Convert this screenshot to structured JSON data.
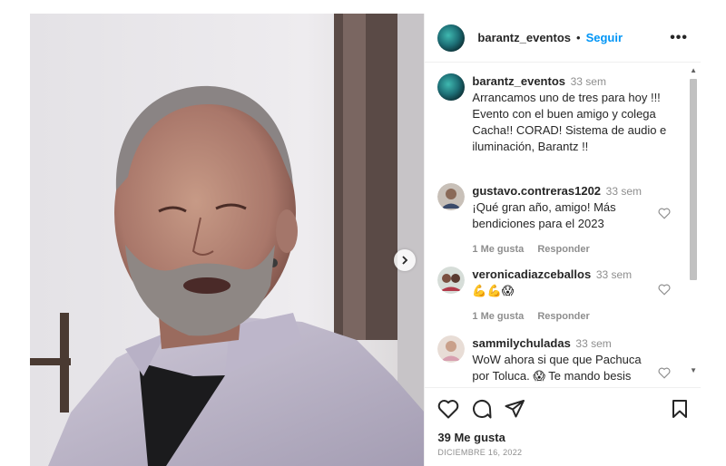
{
  "post": {
    "username": "barantz_eventos",
    "separator": "•",
    "follow_label": "Seguir",
    "more_label": "•••",
    "caption": {
      "username": "barantz_eventos",
      "time": "33 sem",
      "text": "Arrancamos uno de tres para hoy !!! Evento con el buen amigo y colega Cacha!! CORAD! Sistema de audio e iluminación, Barantz !!"
    },
    "comments": [
      {
        "username": "gustavo.contreras1202",
        "time": "33 sem",
        "text": "¡Qué gran año, amigo! Más bendiciones para el 2023",
        "likes_label": "1 Me gusta",
        "reply_label": "Responder"
      },
      {
        "username": "veronicadiazceballos",
        "time": "33 sem",
        "text": "💪💪😱",
        "likes_label": "1 Me gusta",
        "reply_label": "Responder"
      },
      {
        "username": "sammilychuladas",
        "time": "33 sem",
        "text": "WoW ahora si que que Pachuca por Toluca. 😱 Te mando besis",
        "likes_label": "",
        "reply_label": ""
      }
    ],
    "likes": "39 Me gusta",
    "date": "DICIEMBRE 16, 2022"
  },
  "icons": {
    "heart": "heart-icon",
    "comment": "comment-icon",
    "share": "share-icon",
    "bookmark": "bookmark-icon",
    "next": "chevron-right-icon"
  },
  "colors": {
    "accent": "#0095f6",
    "muted": "#8e8e8e",
    "text": "#262626"
  }
}
